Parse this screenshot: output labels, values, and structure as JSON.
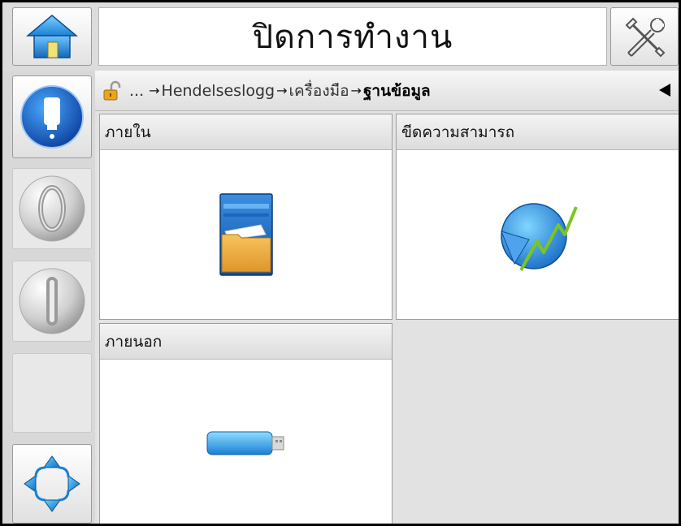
{
  "header": {
    "title": "ปิดการทำงาน",
    "home_icon": "home-icon",
    "tools_icon": "tools-icon"
  },
  "rail": {
    "items": [
      {
        "name": "ink-system-icon",
        "state": "active"
      },
      {
        "name": "start-icon",
        "state": "inactive"
      },
      {
        "name": "stop-icon",
        "state": "inactive"
      },
      {
        "name": "empty-slot",
        "state": "inactive"
      },
      {
        "name": "navigation-arrows-icon",
        "state": "active"
      }
    ]
  },
  "breadcrumb": {
    "ellipsis": "...",
    "segments": [
      "Hendelseslogg",
      "เครื่องมือ",
      "ฐานข้อมูล"
    ],
    "separator": "→"
  },
  "panels": {
    "internal": {
      "label": "ภายใน",
      "icon": "folder-cabinet-icon"
    },
    "capability": {
      "label": "ขีดความสามารถ",
      "icon": "performance-chart-icon"
    },
    "external": {
      "label": "ภายนอก",
      "icon": "usb-drive-icon"
    }
  },
  "colors": {
    "accent_blue": "#1a7fd4",
    "folder_orange": "#e8a33a",
    "chart_green": "#7bc61e"
  }
}
